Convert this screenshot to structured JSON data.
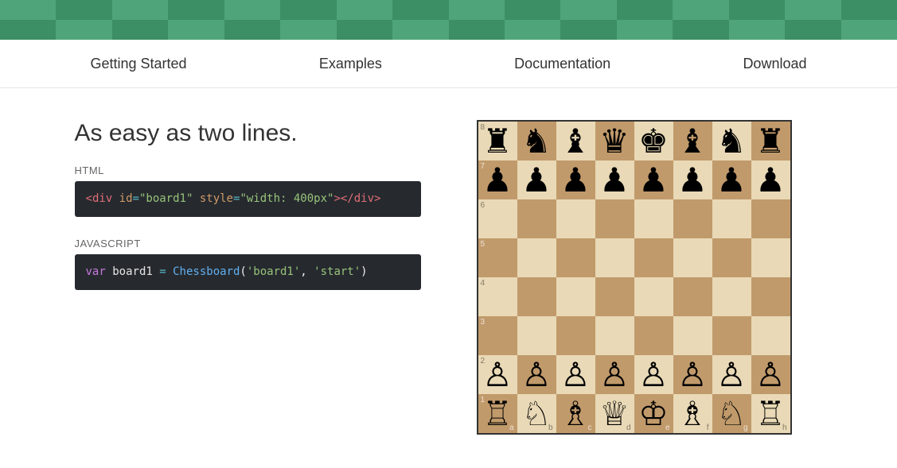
{
  "nav": {
    "items": [
      "Getting Started",
      "Examples",
      "Documentation",
      "Download"
    ]
  },
  "hero": {
    "heading": "As easy as two lines.",
    "html_label": "HTML",
    "js_label": "JAVASCRIPT",
    "html_code": {
      "tag": "div",
      "id_attr": "id",
      "id_val": "\"board1\"",
      "style_attr": "style",
      "style_val": "\"width: 400px\""
    },
    "js_code": {
      "kw": "var",
      "varname": "board1",
      "fn": "Chessboard",
      "arg1": "'board1'",
      "arg2": "'start'"
    }
  },
  "board": {
    "ranks": [
      "8",
      "7",
      "6",
      "5",
      "4",
      "3",
      "2",
      "1"
    ],
    "files": [
      "a",
      "b",
      "c",
      "d",
      "e",
      "f",
      "g",
      "h"
    ],
    "position": [
      [
        "bR",
        "bN",
        "bB",
        "bQ",
        "bK",
        "bB",
        "bN",
        "bR"
      ],
      [
        "bP",
        "bP",
        "bP",
        "bP",
        "bP",
        "bP",
        "bP",
        "bP"
      ],
      [
        "",
        "",
        "",
        "",
        "",
        "",
        "",
        ""
      ],
      [
        "",
        "",
        "",
        "",
        "",
        "",
        "",
        ""
      ],
      [
        "",
        "",
        "",
        "",
        "",
        "",
        "",
        ""
      ],
      [
        "",
        "",
        "",
        "",
        "",
        "",
        "",
        ""
      ],
      [
        "wP",
        "wP",
        "wP",
        "wP",
        "wP",
        "wP",
        "wP",
        "wP"
      ],
      [
        "wR",
        "wN",
        "wB",
        "wQ",
        "wK",
        "wB",
        "wN",
        "wR"
      ]
    ]
  },
  "piece_glyph": {
    "bK": "♚",
    "bQ": "♛",
    "bR": "♜",
    "bB": "♝",
    "bN": "♞",
    "bP": "♟",
    "wK": "♔",
    "wQ": "♕",
    "wR": "♖",
    "wB": "♗",
    "wN": "♘",
    "wP": "♙"
  },
  "colors": {
    "board_light": "#e9d9b6",
    "board_dark": "#c19a6b",
    "code_bg": "#262a2f"
  }
}
